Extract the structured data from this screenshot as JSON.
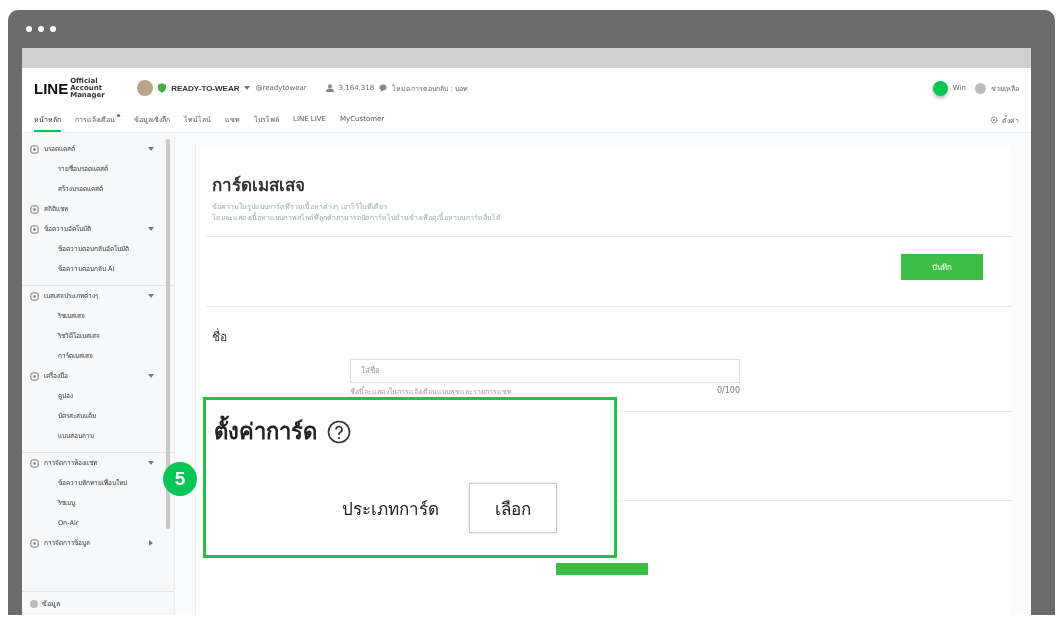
{
  "header": {
    "logo_main": "LINE",
    "logo_sub": "Official Account Manager",
    "account_name": "READY-TO-WEAR",
    "account_id": "@readytowear",
    "friends": "3,164,318",
    "reply_mode": "โหมดการตอบกลับ : บอท",
    "user": "Win",
    "help": "ช่วยเหลือ"
  },
  "nav": {
    "tabs": [
      {
        "label": "หน้าหลัก",
        "selected": true,
        "dot": false
      },
      {
        "label": "การแจ้งเตือน",
        "selected": false,
        "dot": true
      },
      {
        "label": "ข้อมูลเชิงลึก",
        "selected": false,
        "dot": false
      },
      {
        "label": "ไทม์ไลน์",
        "selected": false,
        "dot": false
      },
      {
        "label": "แชท",
        "selected": false,
        "dot": false
      },
      {
        "label": "โปรไฟล์",
        "selected": false,
        "dot": false
      },
      {
        "label": "LINE LIVE",
        "selected": false,
        "dot": false
      },
      {
        "label": "MyCustomer",
        "selected": false,
        "dot": false
      }
    ],
    "settings": "ตั้งค่า"
  },
  "sidebar": {
    "sections": [
      {
        "label": "บรอดแคสต์",
        "expanded": true,
        "divider": false,
        "children": [
          {
            "label": "รายชื่อบรอดแคสต์"
          },
          {
            "label": "สร้างบรอดแคสต์"
          }
        ]
      },
      {
        "label": "สถิติแชท",
        "divider": false
      },
      {
        "label": "ข้อความอัตโนมัติ",
        "expanded": true,
        "divider": false,
        "children": [
          {
            "label": "ข้อความตอบกลับอัตโนมัติ"
          },
          {
            "label": "ข้อความตอบกลับ AI"
          }
        ]
      },
      {
        "label": "เมสเสจประเภทต่างๆ",
        "expanded": true,
        "divider": true,
        "children": [
          {
            "label": "ริชเมสเสจ"
          },
          {
            "label": "ริชวิดีโอเมสเสจ"
          },
          {
            "label": "การ์ดเมสเสจ"
          }
        ]
      },
      {
        "label": "เครื่องมือ",
        "expanded": true,
        "divider": false,
        "children": [
          {
            "label": "คูปอง"
          },
          {
            "label": "บัตรสะสมแต้ม"
          },
          {
            "label": "แบบสอบถาม"
          }
        ]
      },
      {
        "label": "การจัดการห้องแชท",
        "expanded": true,
        "divider": true,
        "children": [
          {
            "label": "ข้อความทักทายเพื่อนใหม่"
          },
          {
            "label": "ริชเมนู"
          },
          {
            "label": "On-Air"
          }
        ]
      },
      {
        "label": "การจัดการข้อมูล",
        "expanded": false,
        "divider": false
      }
    ],
    "footer": "ข้อมูล"
  },
  "page": {
    "title": "การ์ดเมสเสจ",
    "description": [
      "ข้อความในรูปแบบการ์ดที่รวมเนื้อหาต่างๆ เอาไว้ในที่เดียว",
      "โดยจะแสดงเนื้อหาแบบภาพสไลด์ที่ลูกค้าสามารถปัดการ์ดไปด้านข้างเพื่อดูเนื้อหาบนการ์ดอื่นได้"
    ],
    "save": "บันทึก",
    "name_label": "ชื่อ",
    "name_placeholder": "ใส่ชื่อ",
    "name_hint": "ชื่อนี้จะแสดงในการแจ้งเตือนแบบพุชและรายการแชท",
    "name_count": "0/100"
  },
  "callout": {
    "step": "5",
    "title": "ตั้งค่าการ์ด",
    "field_label": "ประเภทการ์ด",
    "button": "เลือก"
  }
}
